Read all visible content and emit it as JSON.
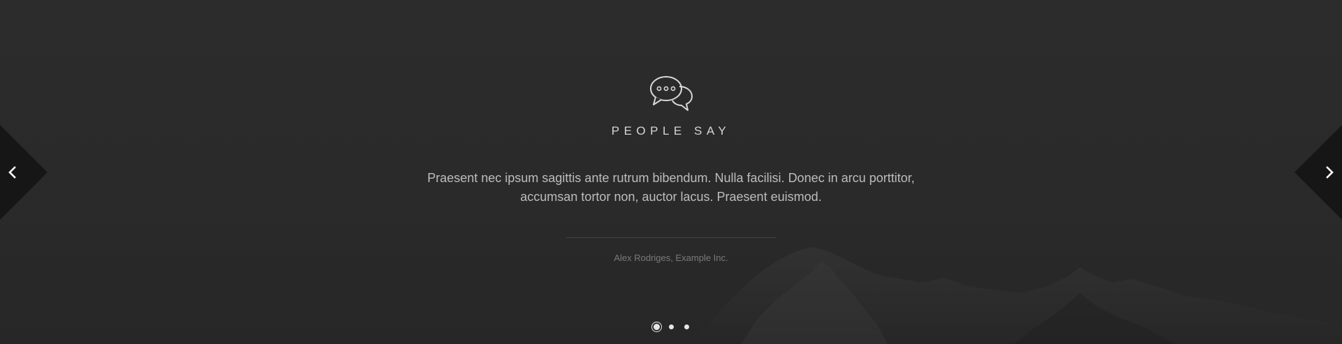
{
  "testimonial": {
    "heading": "PEOPLE SAY",
    "quote": "Praesent nec ipsum sagittis ante rutrum bibendum. Nulla facilisi. Donec in arcu porttitor, accumsan tortor non, auctor lacus. Praesent euismod.",
    "author": "Alex Rodriges, Example Inc.",
    "icon": "speech-bubbles-icon"
  },
  "navigation": {
    "prev_icon": "chevron-left-icon",
    "next_icon": "chevron-right-icon"
  },
  "pagination": {
    "count": 3,
    "active": 1
  },
  "colors": {
    "background": "#2a2a2a",
    "arrow_background": "#161616",
    "heading": "#d6d6d6",
    "quote": "#bdbdbd",
    "author": "#7a7a7a"
  }
}
